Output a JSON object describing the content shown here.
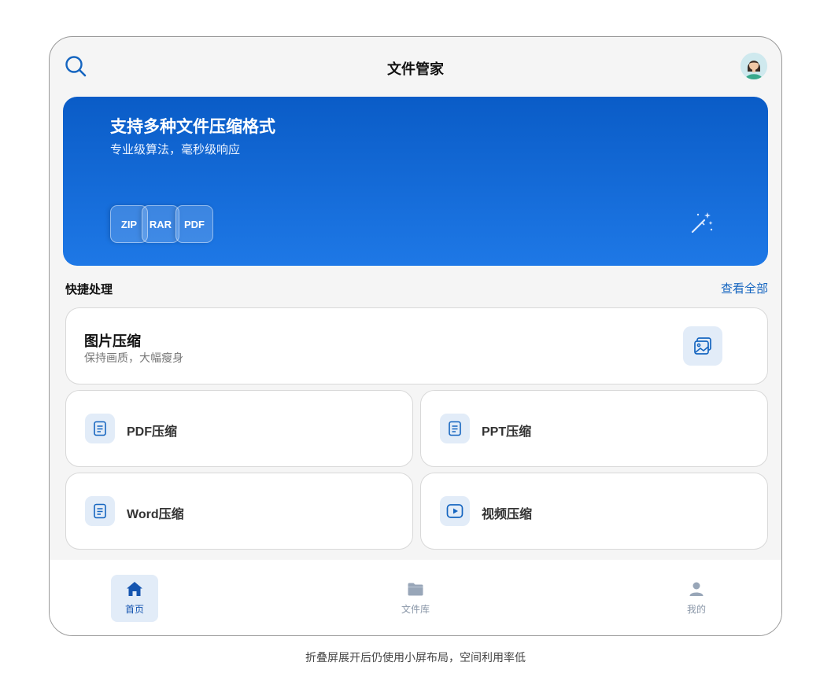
{
  "header": {
    "title": "文件管家"
  },
  "banner": {
    "title": "支持多种文件压缩格式",
    "subtitle": "专业级算法，毫秒级响应",
    "formats": [
      "ZIP",
      "RAR",
      "PDF"
    ]
  },
  "quick": {
    "title": "快捷处理",
    "see_all": "查看全部",
    "featured": {
      "title": "图片压缩",
      "subtitle": "保持画质，大幅瘦身"
    },
    "items": [
      {
        "label": "PDF压缩",
        "icon": "document-icon"
      },
      {
        "label": "PPT压缩",
        "icon": "document-icon"
      },
      {
        "label": "Word压缩",
        "icon": "document-icon"
      },
      {
        "label": "视频压缩",
        "icon": "video-play-icon"
      }
    ]
  },
  "nav": {
    "items": [
      {
        "label": "首页",
        "icon": "home-icon",
        "active": true
      },
      {
        "label": "文件库",
        "icon": "folder-icon",
        "active": false
      },
      {
        "label": "我的",
        "icon": "person-icon",
        "active": false
      }
    ]
  },
  "caption": "折叠屏展开后仍使用小屏布局，空间利用率低",
  "colors": {
    "accent": "#1565c0",
    "banner_top": "#0a5cc7",
    "banner_bottom": "#1e78e6",
    "icon_bg": "#e2ecf8"
  }
}
